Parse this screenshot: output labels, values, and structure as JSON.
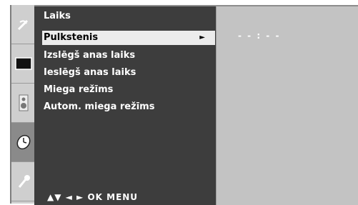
{
  "menu": {
    "title": "Laiks",
    "items": [
      {
        "label": "Pulkstenis",
        "selected": true,
        "has_submenu": true
      },
      {
        "label": "Izslēgš anas laiks",
        "selected": false
      },
      {
        "label": "Ieslēgš anas laiks",
        "selected": false
      },
      {
        "label": "Miega režīms",
        "selected": false
      },
      {
        "label": "Autom. miega režīms",
        "selected": false
      }
    ],
    "submenu_arrow": "►"
  },
  "hint": {
    "text": "▲▼ ◄ ► OK MENU"
  },
  "value_panel": {
    "value": "- - : - -"
  },
  "rail": {
    "icons": [
      "satellite-dish-icon",
      "screen-icon",
      "speaker-icon",
      "clock-icon",
      "key-icon"
    ],
    "active_index": 3
  },
  "colors": {
    "menu_bg": "#3d3d3d",
    "rail_bg": "#cfcfcf",
    "value_bg": "#c3c3c3",
    "highlight": "#ececec"
  }
}
